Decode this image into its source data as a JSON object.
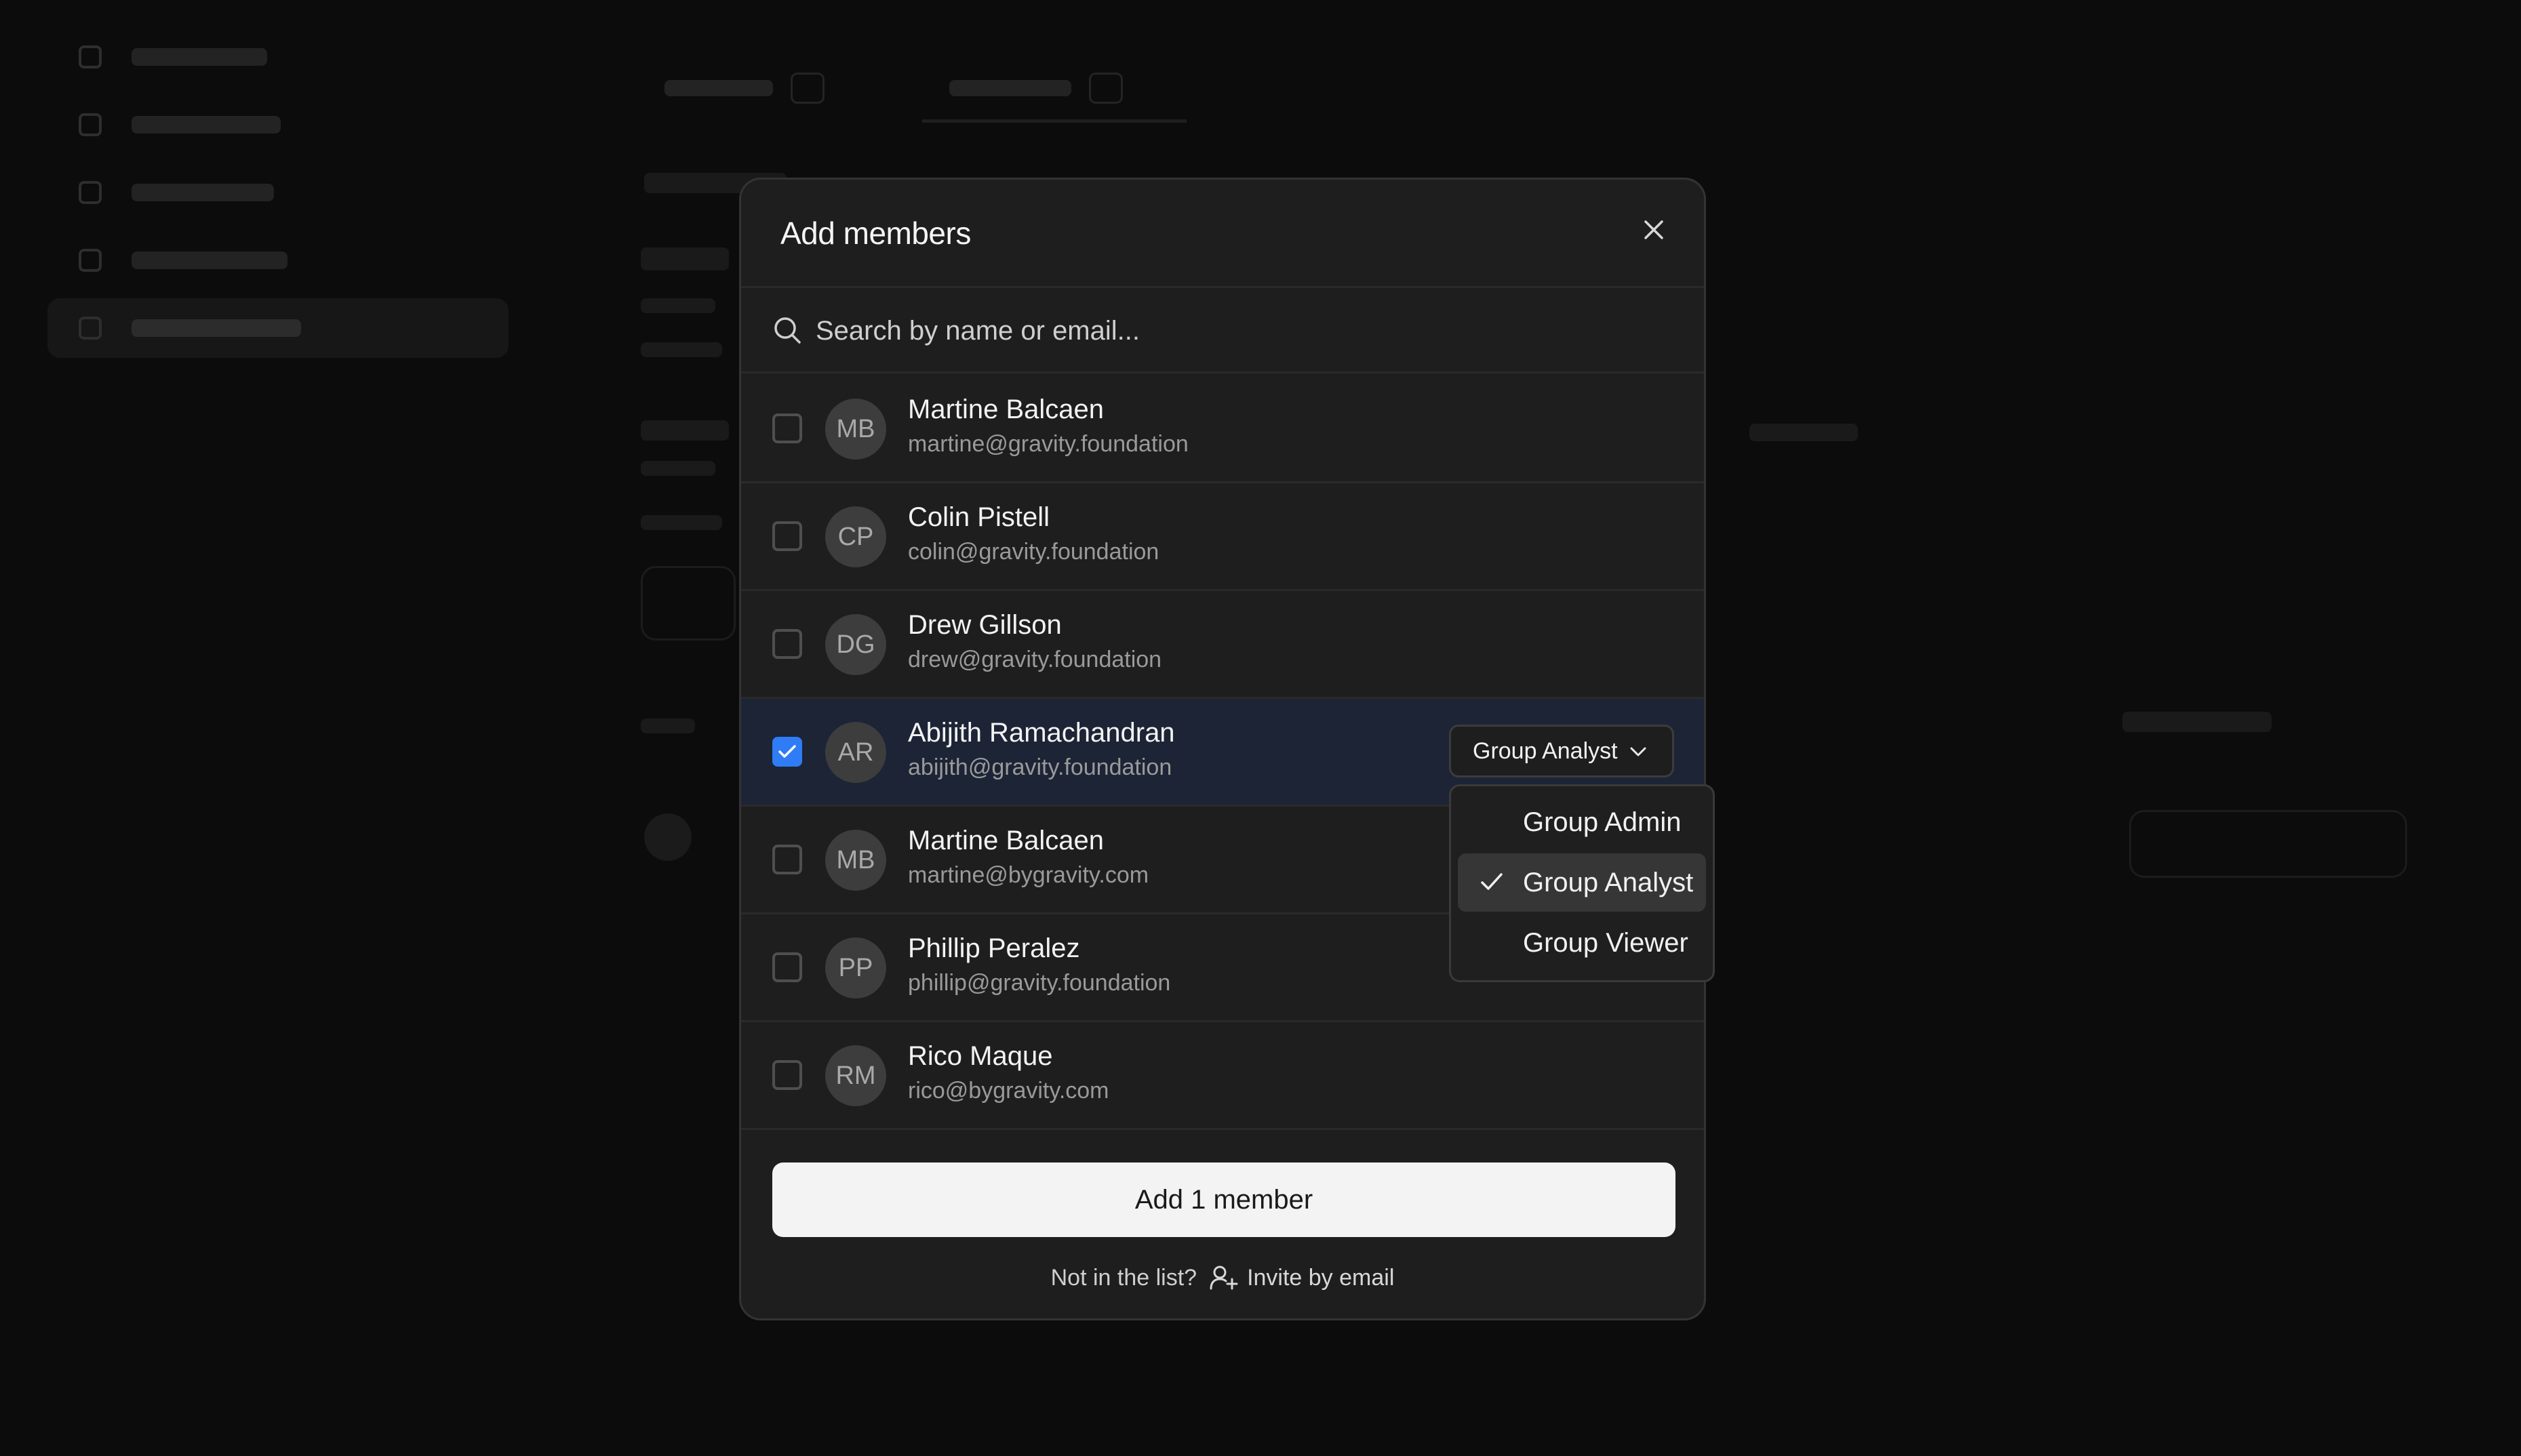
{
  "modal": {
    "title": "Add members",
    "search_placeholder": "Search by name or email...",
    "members": [
      {
        "initials": "MB",
        "name": "Martine Balcaen",
        "email": "martine@gravity.foundation",
        "checked": false
      },
      {
        "initials": "CP",
        "name": "Colin Pistell",
        "email": "colin@gravity.foundation",
        "checked": false
      },
      {
        "initials": "DG",
        "name": "Drew Gillson",
        "email": "drew@gravity.foundation",
        "checked": false
      },
      {
        "initials": "AR",
        "name": "Abijith Ramachandran",
        "email": "abijith@gravity.foundation",
        "checked": true,
        "role": "Group Analyst"
      },
      {
        "initials": "MB",
        "name": "Martine Balcaen",
        "email": "martine@bygravity.com",
        "checked": false
      },
      {
        "initials": "PP",
        "name": "Phillip Peralez",
        "email": "phillip@gravity.foundation",
        "checked": false
      },
      {
        "initials": "RM",
        "name": "Rico Maque",
        "email": "rico@bygravity.com",
        "checked": false
      }
    ],
    "role_dropdown": {
      "options": [
        "Group Admin",
        "Group Analyst",
        "Group Viewer"
      ],
      "selected": "Group Analyst"
    },
    "add_button_label": "Add 1 member",
    "footer_prompt": "Not in the list?",
    "invite_label": "Invite by email"
  },
  "colors": {
    "accent": "#2f7cf6",
    "modal_bg": "#1e1e1e",
    "selected_row_bg": "#1c2436",
    "page_bg": "#0c0c0c"
  },
  "icons": {
    "close": "close-icon",
    "search": "search-icon",
    "check": "check-icon",
    "chevron": "chevron-down-icon",
    "invite": "user-plus-icon"
  }
}
